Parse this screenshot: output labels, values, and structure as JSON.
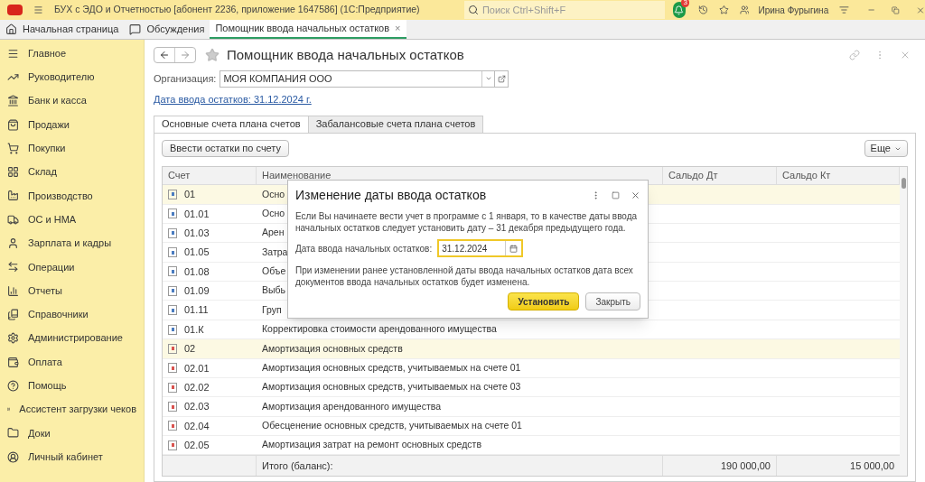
{
  "window": {
    "title": "БУХ с ЭДО и Отчетностью [абонент 2236, приложение 1647586]  (1С:Предприятие)",
    "search_placeholder": "Поиск Ctrl+Shift+F",
    "notifications": "3",
    "user": "Ирина Фурыгина"
  },
  "open_tabs": [
    {
      "label": "Начальная страница",
      "kind": "home",
      "selected": false
    },
    {
      "label": "Обсуждения",
      "kind": "chat",
      "selected": false
    },
    {
      "label": "Помощник ввода начальных остатков",
      "kind": "plain",
      "selected": true,
      "close": "×"
    }
  ],
  "sidebar": {
    "items": [
      {
        "label": "Главное",
        "kind": "menu"
      },
      {
        "label": "Руководителю",
        "kind": "trend"
      },
      {
        "label": "Банк и касса",
        "kind": "bank"
      },
      {
        "label": "Продажи",
        "kind": "bag"
      },
      {
        "label": "Покупки",
        "kind": "cart"
      },
      {
        "label": "Склад",
        "kind": "grid"
      },
      {
        "label": "Производство",
        "kind": "factory"
      },
      {
        "label": "ОС и НМА",
        "kind": "truck"
      },
      {
        "label": "Зарплата и кадры",
        "kind": "user"
      },
      {
        "label": "Операции",
        "kind": "ops"
      },
      {
        "label": "Отчеты",
        "kind": "chart"
      },
      {
        "label": "Справочники",
        "kind": "books"
      },
      {
        "label": "Администрирование",
        "kind": "gear"
      },
      {
        "label": "Оплата",
        "kind": "wallet"
      },
      {
        "label": "Помощь",
        "kind": "help"
      },
      {
        "label": "Ассистент загрузки чеков",
        "kind": "tiles"
      },
      {
        "label": "Доки",
        "kind": "folder"
      },
      {
        "label": "Личный кабинет",
        "kind": "account"
      }
    ]
  },
  "form": {
    "title": "Помощник ввода начальных остатков",
    "organization_label": "Организация:",
    "organization": "МОЯ КОМПАНИЯ ООО",
    "date_link": "Дата ввода остатков: 31.12.2024 г.",
    "tabs": [
      {
        "label": "Основные счета плана счетов",
        "selected": true
      },
      {
        "label": "Забалансовые счета плана счетов",
        "selected": false
      }
    ],
    "enter_button": "Ввести остатки по счету",
    "more_button": "Еще",
    "table": {
      "columns": [
        "Счет",
        "Наименование",
        "Сальдо Дт",
        "Сальдо Кт"
      ],
      "rows": [
        {
          "account": "01",
          "name": "Осно",
          "highlighted": true,
          "color": "#4a7cc0"
        },
        {
          "account": "01.01",
          "name": "Осно",
          "highlighted": false,
          "color": "#4a7cc0"
        },
        {
          "account": "01.03",
          "name": "Арен",
          "highlighted": false,
          "color": "#4a7cc0"
        },
        {
          "account": "01.05",
          "name": "Затра",
          "highlighted": false,
          "color": "#4a7cc0"
        },
        {
          "account": "01.08",
          "name": "Объе",
          "highlighted": false,
          "color": "#4a7cc0"
        },
        {
          "account": "01.09",
          "name": "Выбь",
          "highlighted": false,
          "color": "#4a7cc0"
        },
        {
          "account": "01.11",
          "name": "Груп",
          "highlighted": false,
          "color": "#4a7cc0"
        },
        {
          "account": "01.К",
          "name": "Корректировка стоимости арендованного имущества",
          "highlighted": false,
          "color": "#4a7cc0"
        },
        {
          "account": "02",
          "name": "Амортизация основных средств",
          "highlighted": true,
          "color": "#d9534f"
        },
        {
          "account": "02.01",
          "name": "Амортизация основных средств, учитываемых на счете 01",
          "highlighted": false,
          "color": "#d9534f"
        },
        {
          "account": "02.02",
          "name": "Амортизация основных средств, учитываемых на счете 03",
          "highlighted": false,
          "color": "#d9534f"
        },
        {
          "account": "02.03",
          "name": "Амортизация арендованного имущества",
          "highlighted": false,
          "color": "#d9534f"
        },
        {
          "account": "02.04",
          "name": "Обесценение основных средств, учитываемых на счете 01",
          "highlighted": false,
          "color": "#d9534f"
        },
        {
          "account": "02.05",
          "name": "Амортизация затрат на ремонт основных средств",
          "highlighted": false,
          "color": "#d9534f"
        }
      ],
      "total": {
        "label": "Итого (баланс):",
        "debit": "190 000,00",
        "credit": "15 000,00"
      }
    }
  },
  "dialog": {
    "title": "Изменение даты ввода остатков",
    "intro": "Если Вы начинаете вести учет в программе с 1 января, то в качестве даты ввода начальных остатков следует установить дату – 31 декабря предыдущего года.",
    "date_label": "Дата ввода начальных остатков:",
    "date_value": "31.12.2024",
    "note": "При изменении ранее установленной даты ввода начальных остатков дата всех документов ввода начальных остатков будет изменена.",
    "primary_button": "Установить",
    "close_button": "Закрыть"
  }
}
